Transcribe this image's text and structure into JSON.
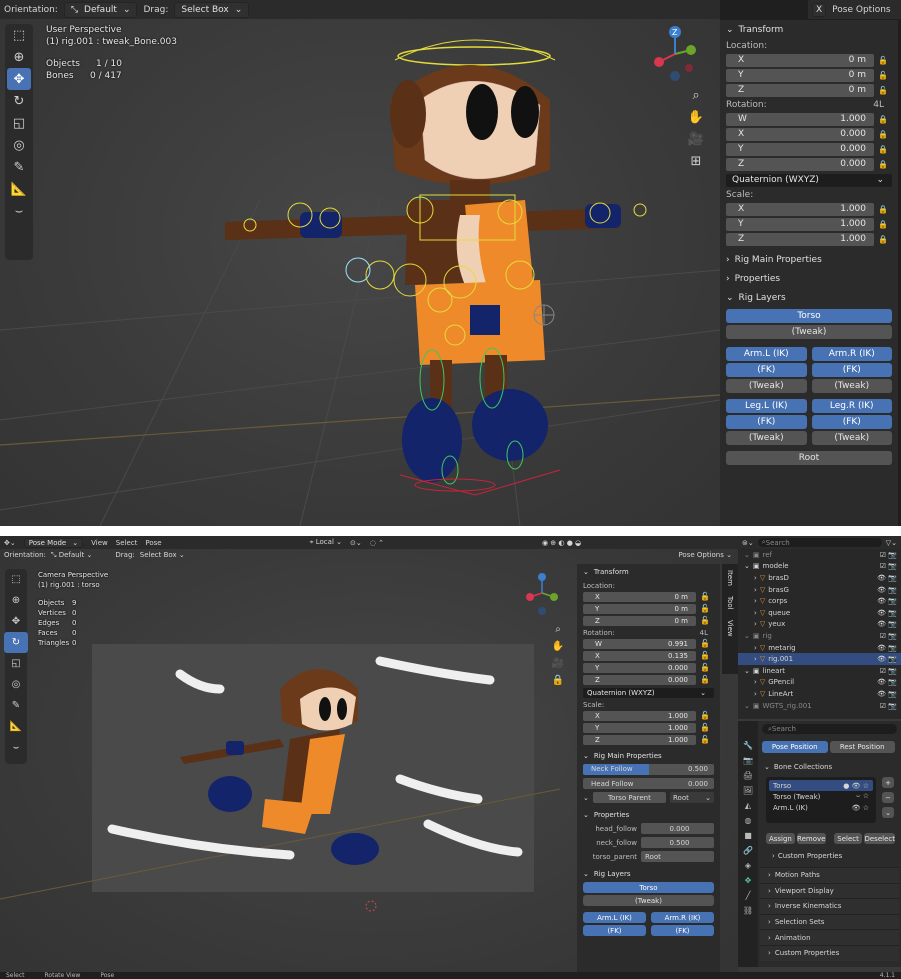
{
  "shot1": {
    "header": {
      "orientation_label": "Orientation:",
      "orientation_value": "Default",
      "drag_label": "Drag:",
      "drag_value": "Select Box",
      "pose_options": "Pose Options",
      "x_label": "X"
    },
    "overlay": {
      "view": "User Perspective",
      "active": "(1) rig.001 : tweak_Bone.003",
      "objects_label": "Objects",
      "objects_value": "1 / 10",
      "bones_label": "Bones",
      "bones_value": "0 / 417"
    },
    "transform": {
      "title": "Transform",
      "location_label": "Location:",
      "location": [
        {
          "axis": "X",
          "value": "0 m"
        },
        {
          "axis": "Y",
          "value": "0 m"
        },
        {
          "axis": "Z",
          "value": "0 m"
        }
      ],
      "rotation_label": "Rotation:",
      "rotation_mode_badge": "4L",
      "rotation": [
        {
          "axis": "W",
          "value": "1.000"
        },
        {
          "axis": "X",
          "value": "0.000"
        },
        {
          "axis": "Y",
          "value": "0.000"
        },
        {
          "axis": "Z",
          "value": "0.000"
        }
      ],
      "rotation_mode": "Quaternion (WXYZ)",
      "scale_label": "Scale:",
      "scale": [
        {
          "axis": "X",
          "value": "1.000"
        },
        {
          "axis": "Y",
          "value": "1.000"
        },
        {
          "axis": "Z",
          "value": "1.000"
        }
      ]
    },
    "panels": {
      "rig_main": "Rig Main Properties",
      "properties": "Properties",
      "rig_layers": "Rig Layers"
    },
    "layers": {
      "torso": "Torso",
      "tweak": "(Tweak)",
      "arm_l_ik": "Arm.L (IK)",
      "arm_r_ik": "Arm.R (IK)",
      "fk": "(FK)",
      "leg_l_ik": "Leg.L (IK)",
      "leg_r_ik": "Leg.R (IK)",
      "root": "Root"
    },
    "gizmo": {
      "x": "X",
      "y": "Y",
      "z": "Z"
    }
  },
  "shot2": {
    "topbar": {
      "mode": "Pose Mode",
      "menus": [
        "View",
        "Select",
        "Pose"
      ],
      "pivot": "Local"
    },
    "header": {
      "orientation_label": "Orientation:",
      "orientation_value": "Default",
      "drag_label": "Drag:",
      "drag_value": "Select Box",
      "pose_options": "Pose Options"
    },
    "overlay": {
      "view": "Camera Perspective",
      "active": "(1) rig.001 : torso",
      "stats": [
        {
          "label": "Objects",
          "value": "9"
        },
        {
          "label": "Vertices",
          "value": "0"
        },
        {
          "label": "Edges",
          "value": "0"
        },
        {
          "label": "Faces",
          "value": "0"
        },
        {
          "label": "Triangles",
          "value": "0"
        }
      ]
    },
    "side_tabs": [
      "Item",
      "Tool",
      "View"
    ],
    "transform": {
      "title": "Transform",
      "location_label": "Location:",
      "location": [
        {
          "axis": "X",
          "value": "0 m"
        },
        {
          "axis": "Y",
          "value": "0 m"
        },
        {
          "axis": "Z",
          "value": "0 m"
        }
      ],
      "rotation_label": "Rotation:",
      "rotation_mode_badge": "4L",
      "rotation": [
        {
          "axis": "W",
          "value": "0.991"
        },
        {
          "axis": "X",
          "value": "0.135"
        },
        {
          "axis": "Y",
          "value": "0.000"
        },
        {
          "axis": "Z",
          "value": "0.000"
        }
      ],
      "rotation_mode": "Quaternion (WXYZ)",
      "scale_label": "Scale:",
      "scale": [
        {
          "axis": "X",
          "value": "1.000"
        },
        {
          "axis": "Y",
          "value": "1.000"
        },
        {
          "axis": "Z",
          "value": "1.000"
        }
      ]
    },
    "rig_main": {
      "title": "Rig Main Properties",
      "neck_follow_label": "Neck Follow",
      "neck_follow_value": "0.500",
      "neck_follow_fraction": 0.5,
      "head_follow_label": "Head Follow",
      "head_follow_value": "0.000",
      "torso_parent_label": "Torso Parent",
      "torso_parent_value": "Root"
    },
    "properties": {
      "title": "Properties",
      "rows": [
        {
          "label": "head_follow",
          "value": "0.000"
        },
        {
          "label": "neck_follow",
          "value": "0.500"
        },
        {
          "label": "torso_parent",
          "value": "Root"
        }
      ]
    },
    "rig_layers": {
      "title": "Rig Layers",
      "torso": "Torso",
      "tweak": "(Tweak)",
      "arm_l": "Arm.L (IK)",
      "arm_r": "Arm.R (IK)",
      "fk": "(FK)"
    },
    "outliner": {
      "search": "Search",
      "rows": [
        {
          "name": "ref",
          "indent": 0
        },
        {
          "name": "modele",
          "indent": 0
        },
        {
          "name": "brasD",
          "indent": 1
        },
        {
          "name": "brasG",
          "indent": 1
        },
        {
          "name": "corps",
          "indent": 1
        },
        {
          "name": "queue",
          "indent": 1
        },
        {
          "name": "yeux",
          "indent": 1
        },
        {
          "name": "rig",
          "indent": 0
        },
        {
          "name": "metarig",
          "indent": 1
        },
        {
          "name": "rig.001",
          "indent": 1
        },
        {
          "name": "lineart",
          "indent": 0
        },
        {
          "name": "GPencil",
          "indent": 1
        },
        {
          "name": "LineArt",
          "indent": 1
        },
        {
          "name": "WGTS_rig.001",
          "indent": 0
        }
      ]
    },
    "props_editor": {
      "search": "Search",
      "pose_position": "Pose Position",
      "rest_position": "Rest Position",
      "bone_collections": "Bone Collections",
      "collections": [
        "Torso",
        "Torso (Tweak)",
        "Arm.L (IK)"
      ],
      "assign": "Assign",
      "remove": "Remove",
      "select": "Select",
      "deselect": "Deselect",
      "custom_props_inner": "Custom Properties",
      "sections": [
        "Motion Paths",
        "Viewport Display",
        "Inverse Kinematics",
        "Selection Sets",
        "Animation",
        "Custom Properties"
      ]
    },
    "statusbar": {
      "left": "Select",
      "mid": "Rotate View",
      "right": "Pose",
      "version": "4.1.1"
    }
  }
}
